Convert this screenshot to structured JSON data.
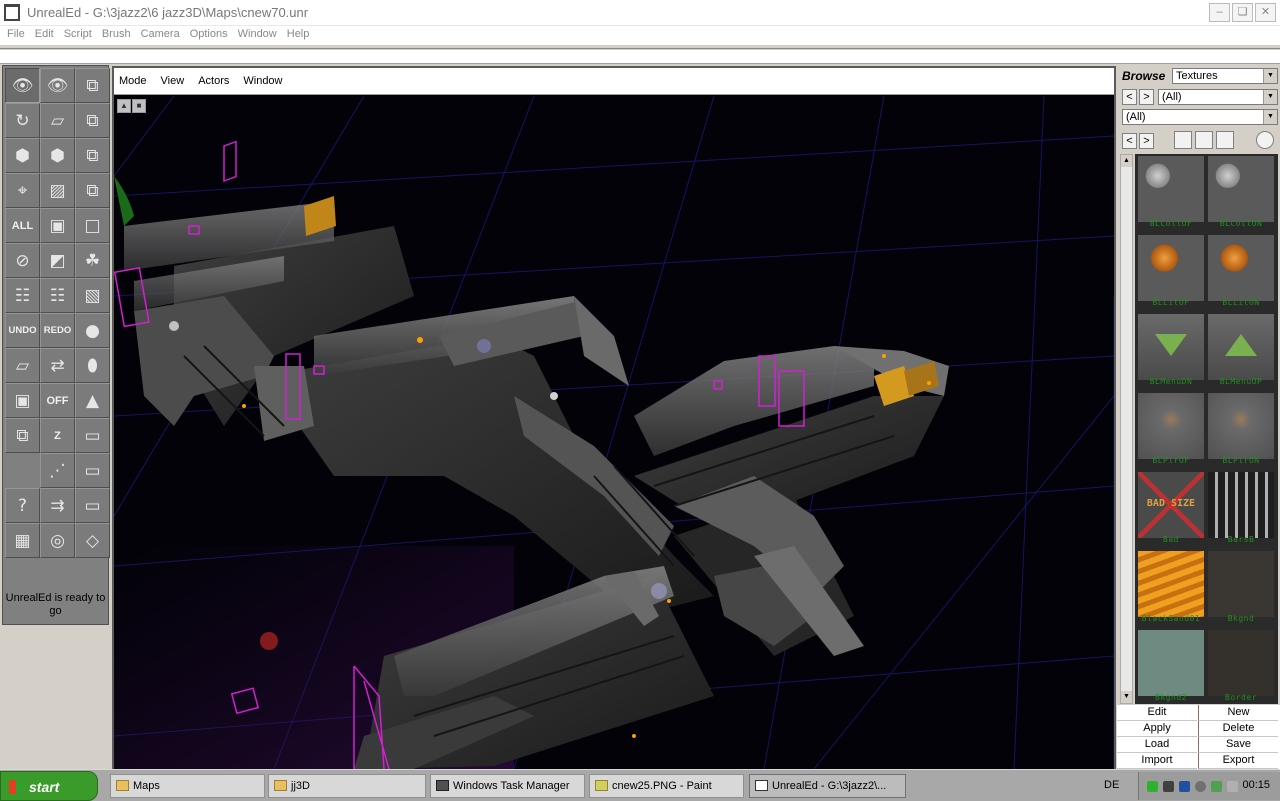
{
  "window": {
    "title": "UnrealEd - G:\\3jazz2\\6 jazz3D\\Maps\\cnew70.unr",
    "controls": [
      "–",
      "❏",
      "✕"
    ]
  },
  "menu": [
    "File",
    "Edit",
    "Script",
    "Brush",
    "Camera",
    "Options",
    "Window",
    "Help"
  ],
  "toolbar": {
    "tools": [
      {
        "name": "camera-move-tool",
        "glyph": "👁"
      },
      {
        "name": "camera-rotate-tool",
        "glyph": "👁"
      },
      {
        "name": "brush-clip-tool",
        "glyph": "⧉"
      },
      {
        "name": "brush-rotate-tool",
        "glyph": "↻"
      },
      {
        "name": "brush-sheer-tool",
        "glyph": "▱"
      },
      {
        "name": "brush-scale-tool",
        "glyph": "⧉"
      },
      {
        "name": "texture-pan-tool",
        "glyph": "⬢"
      },
      {
        "name": "texture-scale-tool",
        "glyph": "⬢"
      },
      {
        "name": "vertex-edit-tool",
        "glyph": "⧉"
      },
      {
        "name": "add-actor-tool",
        "glyph": "⌖"
      },
      {
        "name": "select-box-tool",
        "glyph": "▨"
      },
      {
        "name": "mirror-tool",
        "glyph": "⧉"
      },
      {
        "name": "select-all-button",
        "text": "ALL"
      },
      {
        "name": "show-selected-button",
        "glyph": "▣"
      },
      {
        "name": "select-none-button",
        "glyph": "□"
      },
      {
        "name": "hide-selected-button",
        "glyph": "⊘"
      },
      {
        "name": "invert-selection-button",
        "glyph": "◩"
      },
      {
        "name": "texture-browser-button",
        "glyph": "☘"
      },
      {
        "name": "align-tool",
        "glyph": "☷"
      },
      {
        "name": "snap-vertex-tool",
        "glyph": "☷"
      },
      {
        "name": "cube-builder-button",
        "glyph": "▧"
      },
      {
        "name": "undo-button",
        "text": "UNDO"
      },
      {
        "name": "redo-button",
        "text": "REDO"
      },
      {
        "name": "sphere-builder-button",
        "glyph": "●"
      },
      {
        "name": "add-brush-button",
        "glyph": "▱"
      },
      {
        "name": "subtract-brush-button",
        "glyph": "⇄"
      },
      {
        "name": "cylinder-builder-button",
        "glyph": "⬮"
      },
      {
        "name": "grid-toggle-button",
        "glyph": "▣"
      },
      {
        "name": "off-toggle-button",
        "text": "OFF"
      },
      {
        "name": "cone-builder-button",
        "glyph": "▲"
      },
      {
        "name": "intersect-button",
        "glyph": "⧉"
      },
      {
        "name": "z-lock-button",
        "text": "Z"
      },
      {
        "name": "staircase-builder-button",
        "glyph": "▭"
      },
      {
        "name": "blank-slot",
        "glyph": ""
      },
      {
        "name": "path-tool",
        "glyph": "⋰"
      },
      {
        "name": "spiral-stair-button",
        "glyph": "▭"
      },
      {
        "name": "help-button",
        "glyph": "?"
      },
      {
        "name": "move-tool",
        "glyph": "⇉"
      },
      {
        "name": "curved-stair-button",
        "glyph": "▭"
      },
      {
        "name": "grid-view-button",
        "glyph": "▦"
      },
      {
        "name": "radar-view-button",
        "glyph": "◎"
      },
      {
        "name": "sheet-builder-button",
        "glyph": "◇"
      }
    ],
    "status": "UnrealEd is ready to go"
  },
  "viewport": {
    "menu": [
      "Mode",
      "View",
      "Actors",
      "Window"
    ]
  },
  "browser": {
    "label": "Browse",
    "type": "Textures",
    "package": "(All)",
    "group": "(All)",
    "prev": "<",
    "next": ">",
    "textures": [
      {
        "label": "BLCollOF",
        "kind": "ball"
      },
      {
        "label": "BLCollON",
        "kind": "ball"
      },
      {
        "label": "BLLitOF",
        "kind": "lamp"
      },
      {
        "label": "BLLitON",
        "kind": "lamp"
      },
      {
        "label": "BLMenuDN",
        "kind": "down"
      },
      {
        "label": "BLMenuUP",
        "kind": "up"
      },
      {
        "label": "BLPlrOF",
        "kind": "player"
      },
      {
        "label": "BLPlrON",
        "kind": "player"
      },
      {
        "label": "Bad",
        "kind": "bad",
        "text": "BAD SIZE"
      },
      {
        "label": "BarsB",
        "kind": "bars"
      },
      {
        "label": "BlackSand01",
        "kind": "sand"
      },
      {
        "label": "Bkgnd",
        "kind": "dark"
      },
      {
        "label": "Bkgnd2",
        "kind": "teal"
      },
      {
        "label": "Border",
        "kind": "dark2"
      }
    ],
    "actions": [
      {
        "left": "Edit",
        "right": "New"
      },
      {
        "left": "Apply",
        "right": "Delete"
      },
      {
        "left": "Load",
        "right": "Save"
      },
      {
        "left": "Import",
        "right": "Export"
      }
    ]
  },
  "taskbar": {
    "start": "start",
    "tasks": [
      {
        "label": "Maps",
        "active": false
      },
      {
        "label": "jj3D",
        "active": false
      },
      {
        "label": "Windows Task Manager",
        "active": false
      },
      {
        "label": "cnew25.PNG - Paint",
        "active": false
      },
      {
        "label": "UnrealEd - G:\\3jazz2\\...",
        "active": true
      }
    ],
    "lang": "DE",
    "clock": "00:15"
  }
}
